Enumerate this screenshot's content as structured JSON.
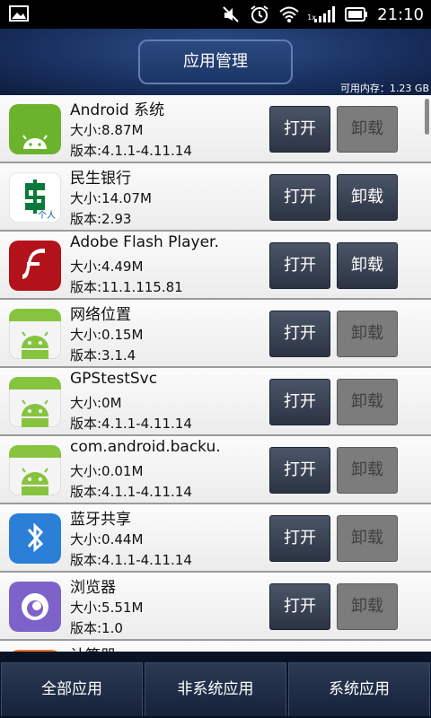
{
  "status_bar": {
    "time": "21:10",
    "icons": [
      "gallery-icon",
      "mute-icon",
      "alarm-icon",
      "wifi-icon",
      "signal-icon",
      "battery-icon"
    ],
    "signal_label": "1x"
  },
  "header": {
    "title": "应用管理",
    "memory": "可用内存：1.23 GB"
  },
  "apps": [
    {
      "name": "Android 系统",
      "size": "大小:8.87M",
      "version": "版本:4.1.1-4.11.14",
      "icon": "miui-android-icon",
      "open": "打开",
      "uninstall": "卸载",
      "uninstall_enabled": false
    },
    {
      "name": "民生银行",
      "size": "大小:14.07M",
      "version": "版本:2.93",
      "icon": "minsheng-bank-icon",
      "icon_text": "个人",
      "open": "打开",
      "uninstall": "卸载",
      "uninstall_enabled": true
    },
    {
      "name": "Adobe Flash Player.",
      "size": "大小:4.49M",
      "version": "版本:11.1.115.81",
      "icon": "flash-icon",
      "open": "打开",
      "uninstall": "卸载",
      "uninstall_enabled": true
    },
    {
      "name": "网络位置",
      "size": "大小:0.15M",
      "version": "版本:3.1.4",
      "icon": "android-icon",
      "open": "打开",
      "uninstall": "卸载",
      "uninstall_enabled": false
    },
    {
      "name": "GPStestSvc",
      "size": "大小:0M",
      "version": "版本:4.1.1-4.11.14",
      "icon": "android-icon",
      "open": "打开",
      "uninstall": "卸载",
      "uninstall_enabled": false
    },
    {
      "name": "com.android.backu.",
      "size": "大小:0.01M",
      "version": "版本:4.1.1-4.11.14",
      "icon": "android-icon",
      "open": "打开",
      "uninstall": "卸载",
      "uninstall_enabled": false
    },
    {
      "name": "蓝牙共享",
      "size": "大小:0.44M",
      "version": "版本:4.1.1-4.11.14",
      "icon": "bluetooth-icon",
      "open": "打开",
      "uninstall": "卸载",
      "uninstall_enabled": false
    },
    {
      "name": "浏览器",
      "size": "大小:5.51M",
      "version": "版本:1.0",
      "icon": "browser-icon",
      "open": "打开",
      "uninstall": "卸载",
      "uninstall_enabled": false
    },
    {
      "name": "计算器",
      "icon": "calculator-icon"
    }
  ],
  "tabs": [
    {
      "label": "全部应用"
    },
    {
      "label": "非系统应用"
    },
    {
      "label": "系统应用"
    }
  ]
}
